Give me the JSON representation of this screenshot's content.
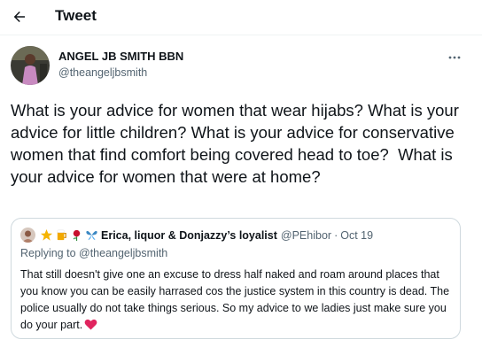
{
  "header": {
    "title": "Tweet"
  },
  "tweet": {
    "author_name": "ANGEL JB SMITH BBN",
    "author_handle": "@theangeljbsmith",
    "text": "What is your advice for women that wear hijabs? What is your advice for little children? What is your advice for conservative women that find comfort being covered head to toe?  What is your advice for women that were at home?"
  },
  "quote": {
    "author_name": "Erica, liquor & Donjazzy’s loyalist",
    "author_handle": "@PEhibor",
    "separator": "·",
    "date": "Oct 19",
    "replying_to": "Replying to @theangeljbsmith",
    "text": "That still doesn't give one an excuse to dress half naked and roam around places that you know you can be easily harrased cos the justice system in this country is dead. The police usually do not take things serious. So my advice to we ladies just make sure you do your part."
  },
  "icons": [
    "back-arrow-icon",
    "more-icon",
    "star-emoji",
    "beer-emoji",
    "rose-emoji",
    "butterfly-emoji",
    "heart-emoji"
  ],
  "colors": {
    "secondary_text": "#536471",
    "border": "#cfd9de",
    "heart": "#e0245e"
  }
}
